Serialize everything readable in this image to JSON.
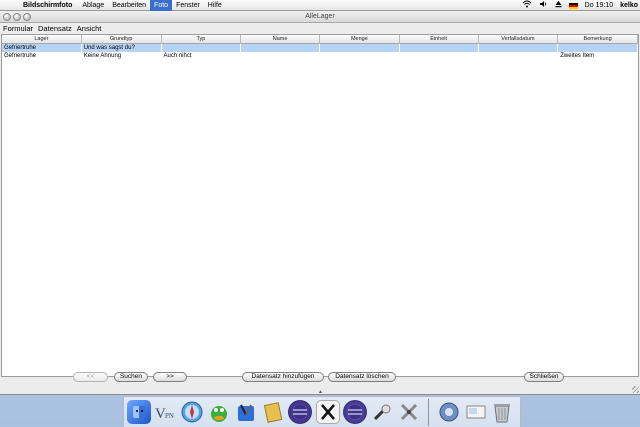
{
  "menubar": {
    "app_name": "Bildschirmfoto",
    "items": [
      "Ablage",
      "Bearbeiten",
      "Foto",
      "Fenster",
      "Hilfe"
    ],
    "selected_item": "Foto",
    "clock": "Do 19:10",
    "user": "kelko"
  },
  "window": {
    "title": "AlleLager",
    "menu": [
      "Formular",
      "Datensatz",
      "Ansicht"
    ]
  },
  "table": {
    "columns": [
      "Lager",
      "Grundtyp",
      "Typ",
      "Name",
      "Menge",
      "Einheit",
      "Verfallsdatum",
      "Bemerkung"
    ],
    "rows": [
      [
        "Gefriertruhe",
        "Und was sagst du?",
        "",
        "",
        "",
        "",
        "",
        ""
      ],
      [
        "Gefriertruhe",
        "Keine Ahnung",
        "Auch nihct",
        "",
        "",
        "",
        "",
        "Zweites Item"
      ]
    ],
    "selected_row": 0
  },
  "buttons": {
    "prev": "<<",
    "search": "Suchen",
    "next": ">>",
    "add": "Datensatz hinzufügen",
    "delete": "Datensatz löschen",
    "close": "Schließen"
  },
  "colors": {
    "selection": "#b7d2f5",
    "menu_highlight": "#3a6fd0"
  },
  "dock": {
    "items": [
      "finder-icon",
      "vpn-icon",
      "safari-icon",
      "adium-icon",
      "xcode-icon",
      "script-icon",
      "eclipse-icon",
      "x11-icon",
      "eclipse-icon",
      "pen-icon",
      "tools-icon",
      "preferences-icon",
      "screenshot-icon",
      "trash-icon"
    ]
  }
}
